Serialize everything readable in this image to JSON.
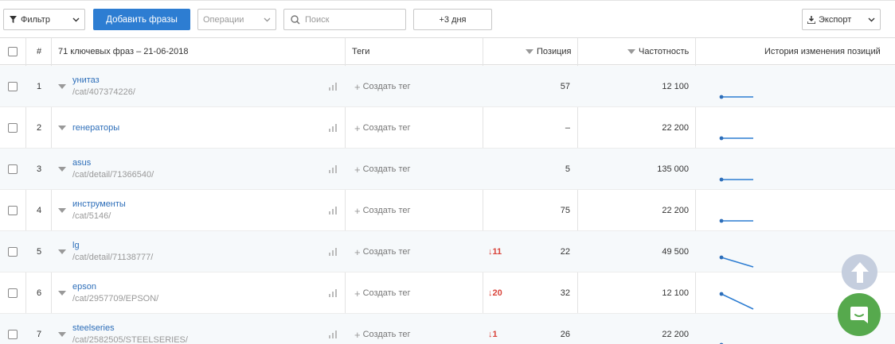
{
  "toolbar": {
    "filter_label": "Фильтр",
    "add_label": "Добавить фразы",
    "operations_label": "Операции",
    "search_placeholder": "Поиск",
    "days_label": "+3 дня",
    "export_label": "Экспорт"
  },
  "table": {
    "col_num": "#",
    "col_keywords": "71 ключевых фраз – 21-06-2018",
    "col_tags": "Теги",
    "col_position": "Позиция",
    "col_frequency": "Частотность",
    "col_history": "История изменения позиций",
    "create_tag_label": "Создать тег",
    "rows": [
      {
        "n": "1",
        "name": "унитаз",
        "url": "/cat/407374226/",
        "change": "",
        "position": "57",
        "frequency": "12 100",
        "trend": "flat"
      },
      {
        "n": "2",
        "name": "генераторы",
        "url": "",
        "change": "",
        "position": "–",
        "frequency": "22 200",
        "trend": "flat"
      },
      {
        "n": "3",
        "name": "asus",
        "url": "/cat/detail/71366540/",
        "change": "",
        "position": "5",
        "frequency": "135 000",
        "trend": "flat"
      },
      {
        "n": "4",
        "name": "инструменты",
        "url": "/cat/5146/",
        "change": "",
        "position": "75",
        "frequency": "22 200",
        "trend": "flat"
      },
      {
        "n": "5",
        "name": "lg",
        "url": "/cat/detail/71138777/",
        "change": "↓11",
        "position": "22",
        "frequency": "49 500",
        "trend": "down"
      },
      {
        "n": "6",
        "name": "epson",
        "url": "/cat/2957709/EPSON/",
        "change": "↓20",
        "position": "32",
        "frequency": "12 100",
        "trend": "down-steep"
      },
      {
        "n": "7",
        "name": "steelseries",
        "url": "/cat/2582505/STEELSERIES/",
        "change": "↓1",
        "position": "26",
        "frequency": "22 200",
        "trend": "flat"
      }
    ]
  },
  "colors": {
    "accent": "#2d7dd2",
    "link": "#2d6eb9",
    "negative": "#d9443b",
    "chat": "#56a94d"
  }
}
